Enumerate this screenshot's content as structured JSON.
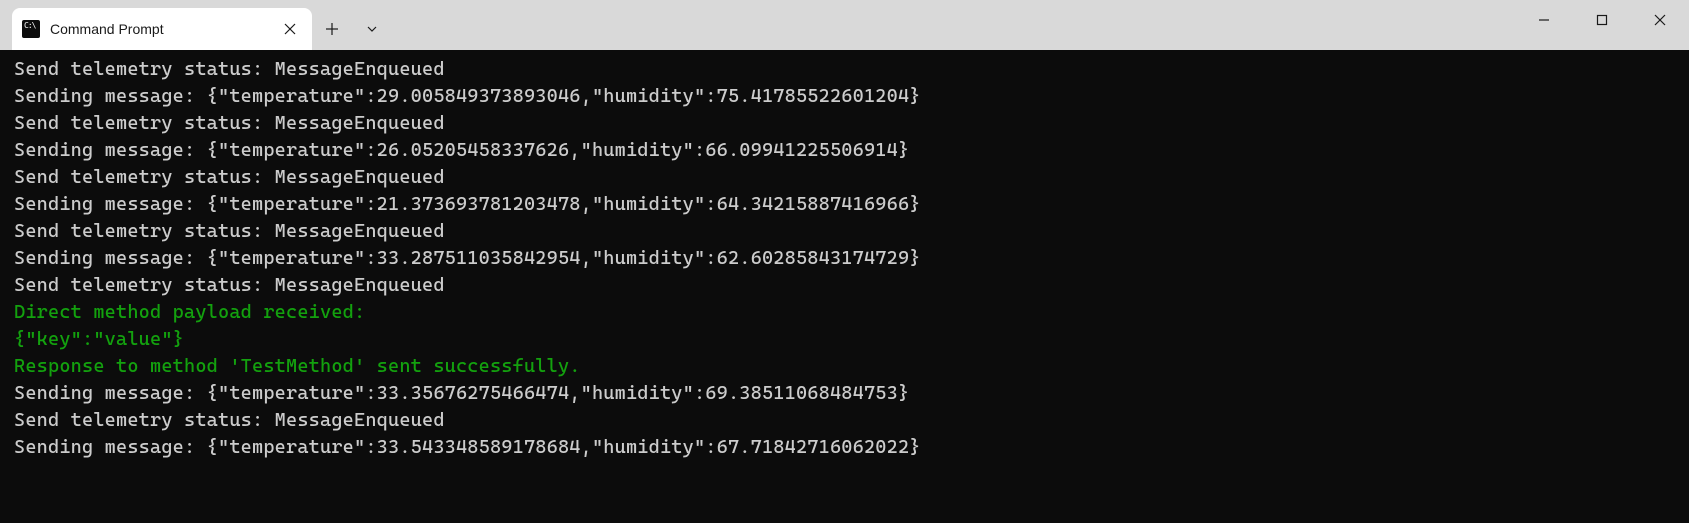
{
  "tab": {
    "title": "Command Prompt"
  },
  "terminal": {
    "lines": [
      {
        "text": "Send telemetry status: MessageEnqueued",
        "color": "normal"
      },
      {
        "text": "Sending message: {\"temperature\":29.005849373893046,\"humidity\":75.41785522601204}",
        "color": "normal"
      },
      {
        "text": "Send telemetry status: MessageEnqueued",
        "color": "normal"
      },
      {
        "text": "Sending message: {\"temperature\":26.05205458337626,\"humidity\":66.09941225506914}",
        "color": "normal"
      },
      {
        "text": "Send telemetry status: MessageEnqueued",
        "color": "normal"
      },
      {
        "text": "Sending message: {\"temperature\":21.373693781203478,\"humidity\":64.34215887416966}",
        "color": "normal"
      },
      {
        "text": "Send telemetry status: MessageEnqueued",
        "color": "normal"
      },
      {
        "text": "Sending message: {\"temperature\":33.287511035842954,\"humidity\":62.60285843174729}",
        "color": "normal"
      },
      {
        "text": "Send telemetry status: MessageEnqueued",
        "color": "normal"
      },
      {
        "text": "Direct method payload received:",
        "color": "green"
      },
      {
        "text": "{\"key\":\"value\"}",
        "color": "green"
      },
      {
        "text": "Response to method 'TestMethod' sent successfully.",
        "color": "green"
      },
      {
        "text": "Sending message: {\"temperature\":33.35676275466474,\"humidity\":69.38511068484753}",
        "color": "normal"
      },
      {
        "text": "Send telemetry status: MessageEnqueued",
        "color": "normal"
      },
      {
        "text": "Sending message: {\"temperature\":33.543348589178684,\"humidity\":67.71842716062022}",
        "color": "normal"
      }
    ]
  }
}
